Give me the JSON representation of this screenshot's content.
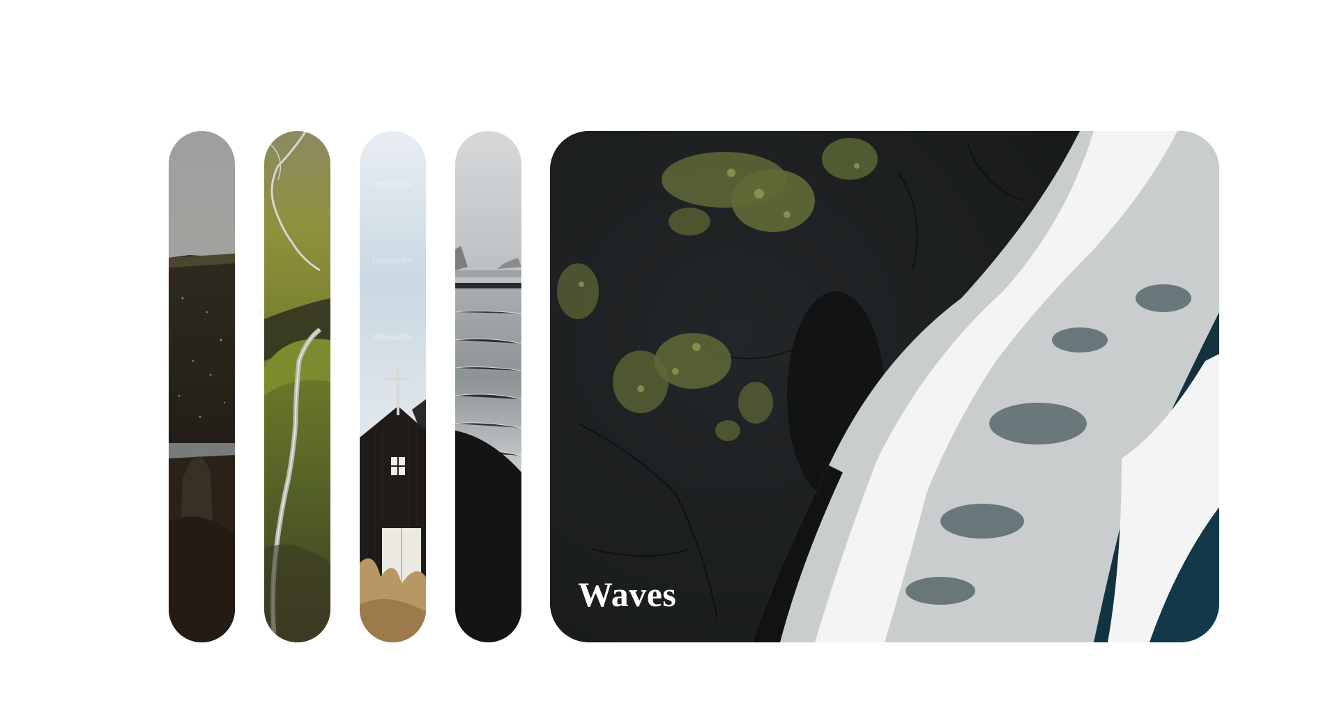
{
  "gallery": {
    "panels": [
      {
        "id": "cliffs",
        "image": "cliff-and-lake-photo",
        "expanded": false
      },
      {
        "id": "valley",
        "image": "river-valley-photo",
        "expanded": false
      },
      {
        "id": "church",
        "image": "black-church-photo",
        "expanded": false,
        "watermark": "Unsplash+"
      },
      {
        "id": "beach",
        "image": "black-sand-beach-photo",
        "expanded": false
      },
      {
        "id": "waves",
        "image": "aerial-waves-photo",
        "expanded": true,
        "label": "Waves"
      }
    ]
  }
}
